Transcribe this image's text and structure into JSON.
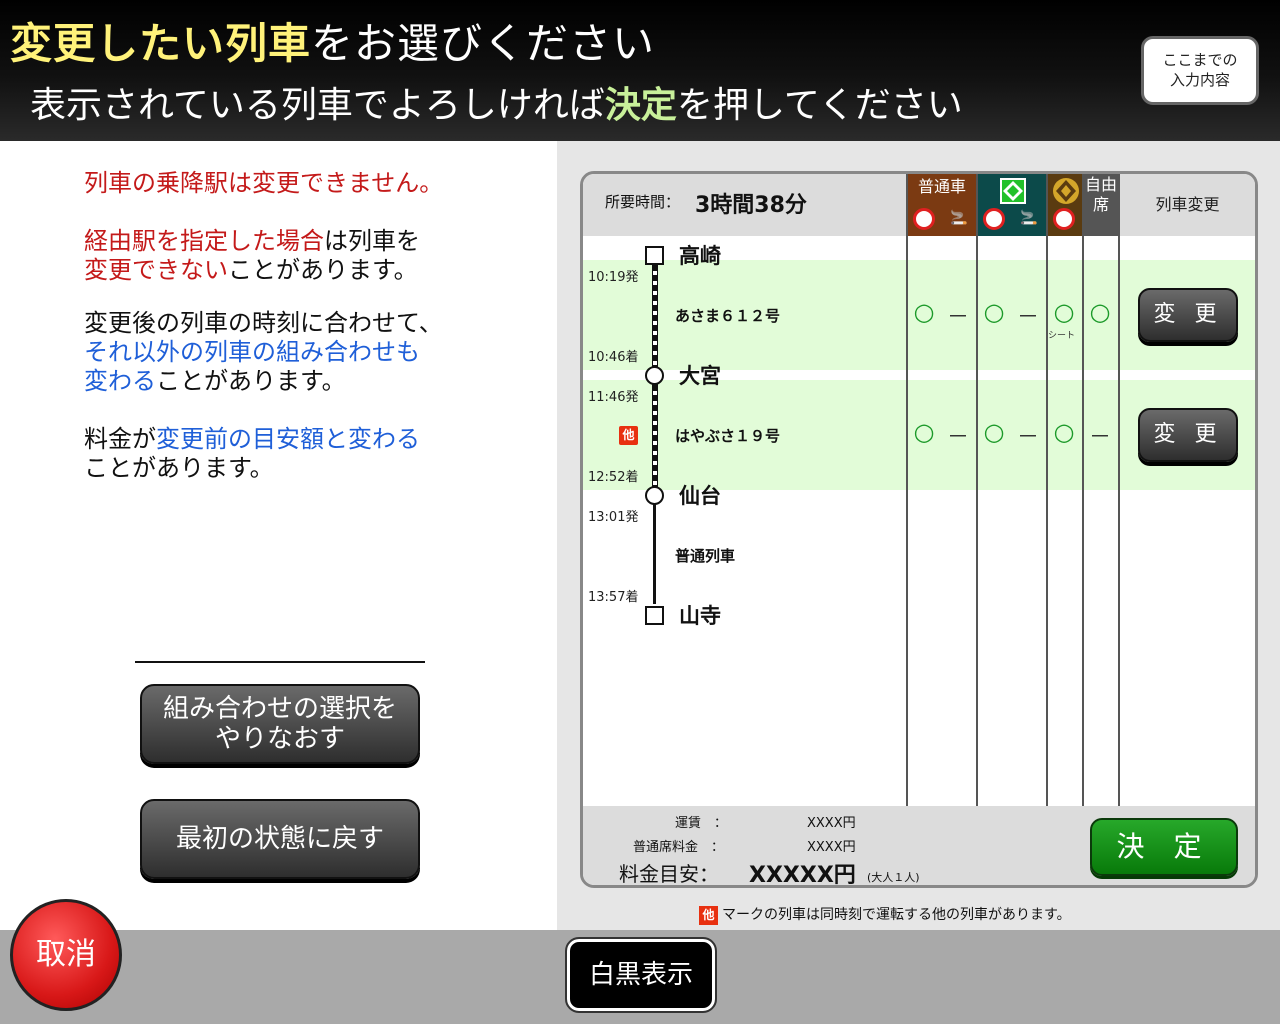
{
  "header": {
    "title_highlight": "変更したい列車",
    "title_rest": "をお選びください",
    "subtitle_pre": "表示されている列車でよろしければ",
    "subtitle_highlight": "決定",
    "subtitle_post": "を押してください",
    "summary_button": "ここまでの\n入力内容"
  },
  "notes": {
    "n1": "列車の乗降駅は変更できません。",
    "n2_red1": "経由駅を指定した場合",
    "n2_black1": "は列車を",
    "n2_red2": "変更できない",
    "n2_black2": "ことがあります。",
    "n3_black1": "変更後の列車の時刻に合わせて、",
    "n3_blue1": "それ以外の列車の組み合わせも",
    "n3_blue2": "変わる",
    "n3_black2": "ことがあります。",
    "n4_black1": "料金が",
    "n4_blue1": "変更前の目安額と変わる",
    "n4_black2": "ことがあります。"
  },
  "buttons": {
    "redo": "組み合わせの選択を\nやりなおす",
    "reset": "最初の状態に戻す",
    "cancel": "取消",
    "bw": "白黒表示",
    "confirm": "決 定",
    "change": "変 更"
  },
  "panel": {
    "duration_label": "所要時間：",
    "duration_value": "3時間38分",
    "columns": {
      "ordinary": "普通車",
      "free": "自由\n席",
      "change": "列車変更"
    },
    "stations": [
      "高崎",
      "大宮",
      "仙台",
      "山寺"
    ],
    "segments": [
      {
        "dep": "10:19発",
        "arr": "10:46着",
        "train": "あさま６１２号",
        "ordinary_ns": "○",
        "ordinary_s": "－",
        "green_ns": "○",
        "green_s": "－",
        "gran": "○",
        "gran_note": "シート",
        "free": "○"
      },
      {
        "dep": "11:46発",
        "arr": "12:52着",
        "train": "はやぶさ１９号",
        "other_mark": "他",
        "ordinary_ns": "○",
        "ordinary_s": "－",
        "green_ns": "○",
        "green_s": "－",
        "gran": "○",
        "free": "－"
      },
      {
        "dep": "13:01発",
        "arr": "13:57着",
        "train": "普通列車"
      }
    ]
  },
  "fare": {
    "base_label": "運賃　：",
    "base_value": "XXXX円",
    "seat_label": "普通席料金　：",
    "seat_value": "XXXX円",
    "estimate_label": "料金目安：",
    "estimate_value": "XXXXX円",
    "estimate_note": "(大人１人)"
  },
  "footnote": {
    "mark": "他",
    "text": "マークの列車は同時刻で運転する他の列車があります。"
  }
}
